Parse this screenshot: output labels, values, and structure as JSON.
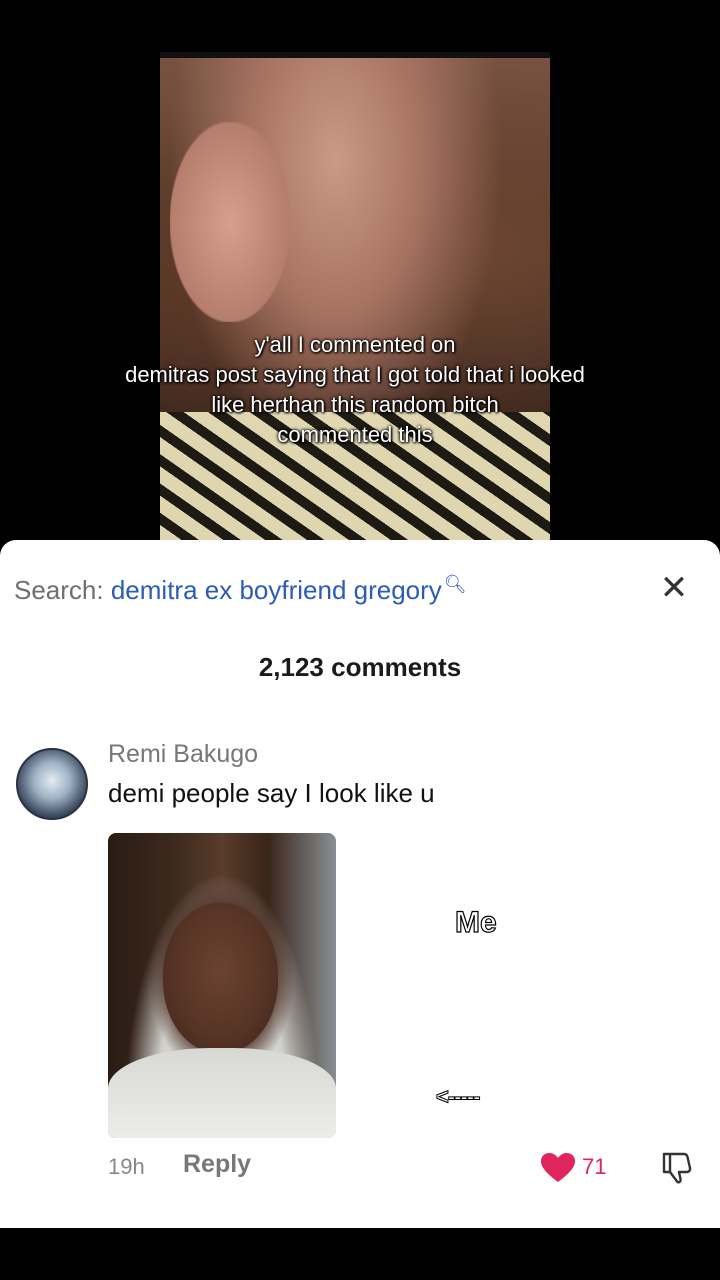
{
  "video": {
    "caption_lines": [
      "y'all I commented on",
      "demitras post saying that I got told that i looked",
      "like herthan this random bitch",
      "commented this"
    ]
  },
  "comments_panel": {
    "search_prefix": "Search:",
    "search_query": "demitra ex boyfriend gregory",
    "search_icon": "search-icon",
    "close_icon": "close-icon",
    "comments_count": "2,123 comments",
    "comment": {
      "username": "Remi Bakugo",
      "text": "demi people say I look like u",
      "time": "19h",
      "reply_label": "Reply",
      "like_count": "71",
      "like_color": "#e0245e"
    },
    "overlay_me": "Me",
    "overlay_arrow": "<-----"
  }
}
